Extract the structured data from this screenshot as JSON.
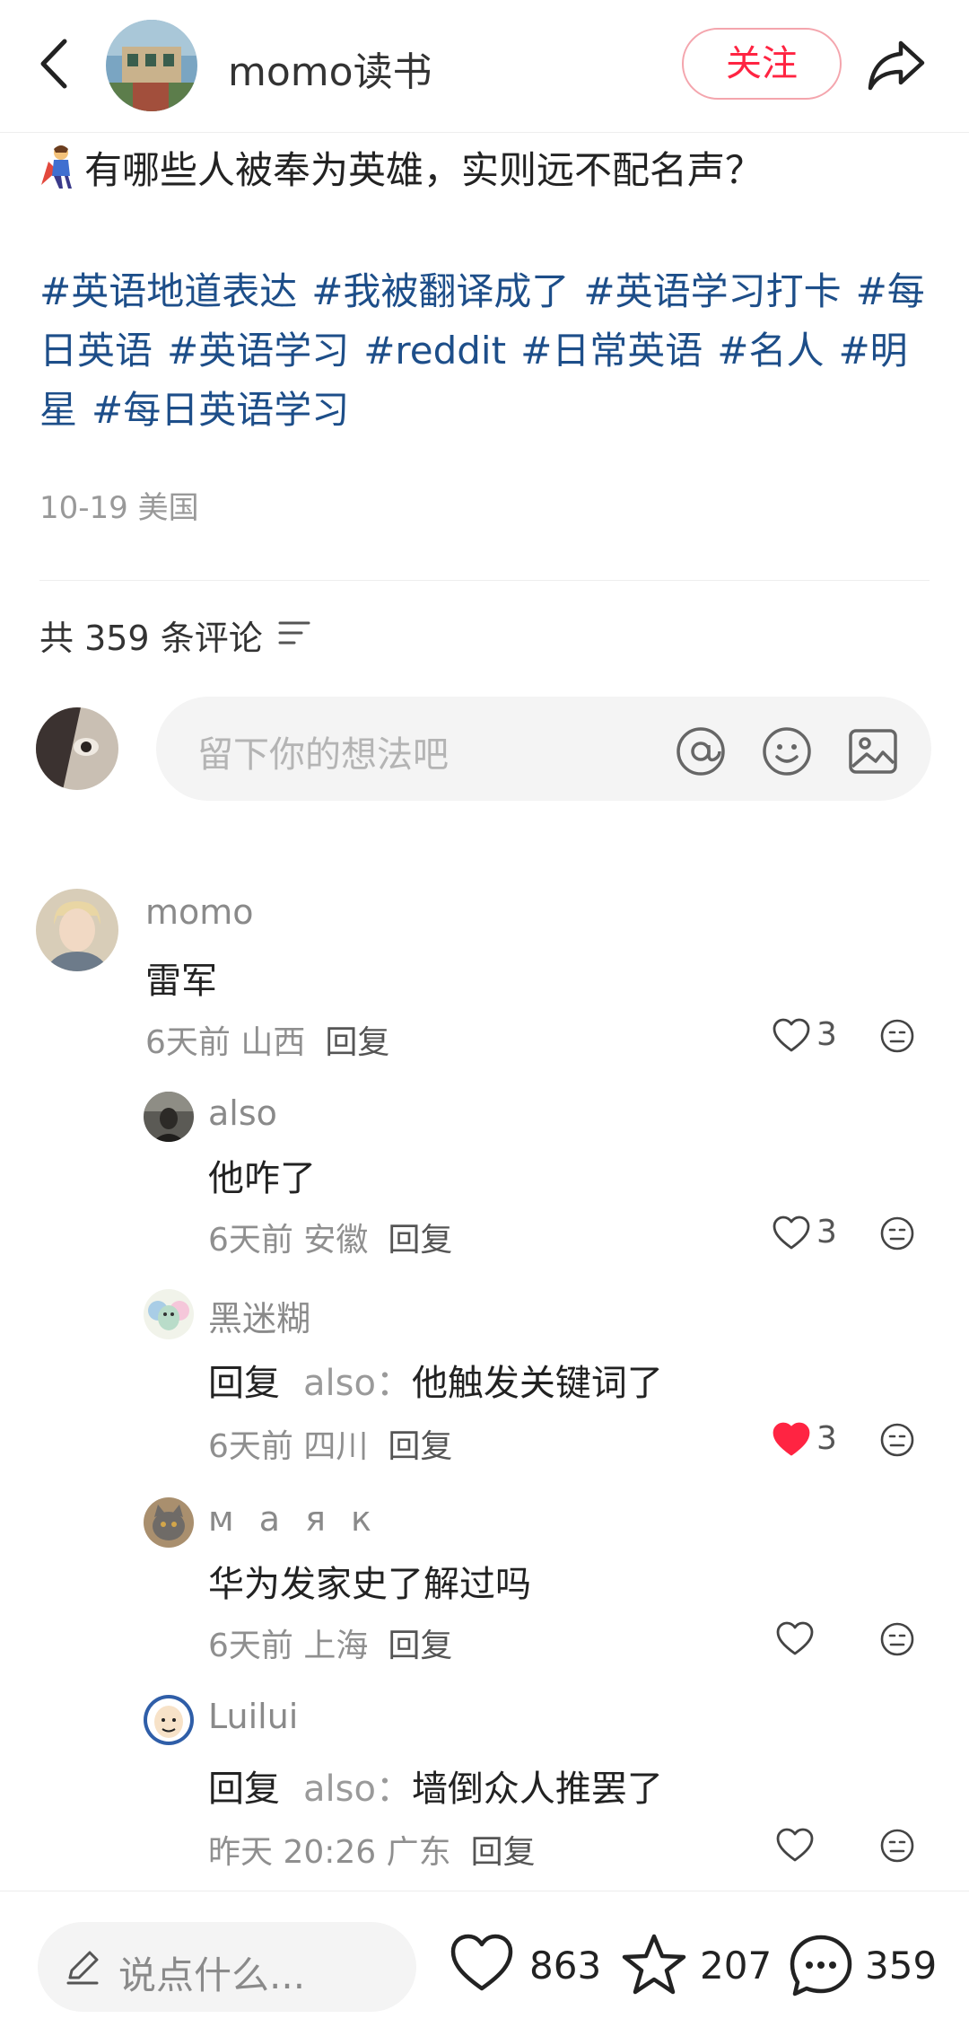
{
  "header": {
    "author_name": "momo读书",
    "follow_label": "关注"
  },
  "post": {
    "title": "有哪些人被奉为英雄，实则远不配名声？",
    "tags": [
      "#英语地道表达",
      "#我被翻译成了",
      "#英语学习打卡",
      "#每日英语",
      "#英语学习",
      "#reddit",
      "#日常英语",
      "#名人",
      "#明星",
      "#每日英语学习"
    ],
    "meta": "10-19 美国"
  },
  "comments_section": {
    "count_label": "共 359 条评论",
    "input_placeholder": "留下你的想法吧"
  },
  "comments": [
    {
      "name": "momo",
      "text": "雷军",
      "meta": "6天前 山西",
      "reply_label": "回复",
      "likes": "3",
      "liked": false
    },
    {
      "name": "also",
      "text": "他咋了",
      "meta": "6天前 安徽",
      "reply_label": "回复",
      "likes": "3",
      "liked": false
    },
    {
      "name": "黑迷糊",
      "reply_prefix": "回复",
      "reply_target": "also：",
      "text": "他触发关键词了",
      "meta": "6天前 四川",
      "reply_label": "回复",
      "likes": "3",
      "liked": true
    },
    {
      "name": "м а я к",
      "text": "华为发家史了解过吗",
      "meta": "6天前 上海",
      "reply_label": "回复",
      "likes": "",
      "liked": false
    },
    {
      "name": "Luilui",
      "reply_prefix": "回复",
      "reply_target": "also：",
      "text": "墙倒众人推罢了",
      "meta": "昨天 20:26 广东",
      "reply_label": "回复",
      "likes": "",
      "liked": false
    }
  ],
  "bottom_bar": {
    "input_placeholder": "说点什么...",
    "likes": "863",
    "collects": "207",
    "comments": "359"
  },
  "colors": {
    "accent": "#ff2442",
    "tag": "#1d4e89",
    "liked_heart": "#ff2442"
  }
}
